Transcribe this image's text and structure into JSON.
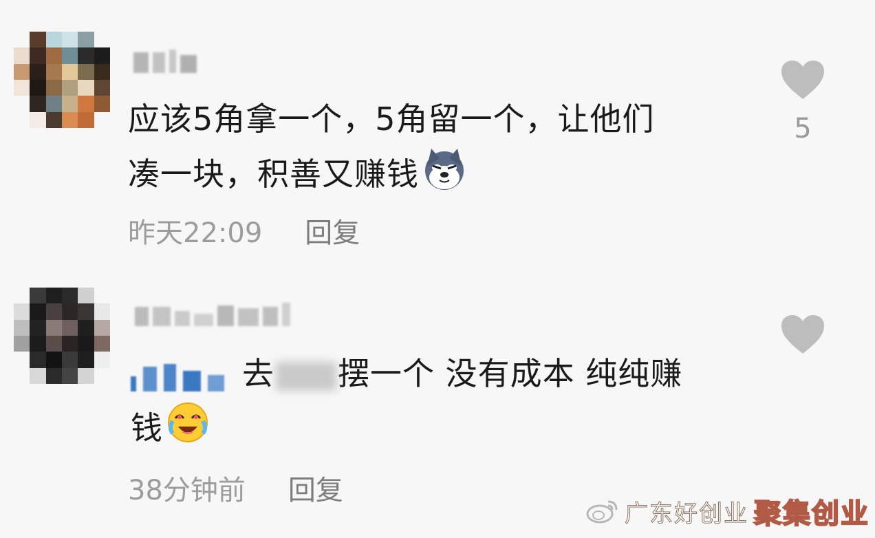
{
  "comments": [
    {
      "content_lines": [
        "应该5角拿一个，5角留一个，让他们",
        "凑一块，积善又赚钱"
      ],
      "emoji": "husky-dog-emoji",
      "time": "昨天22:09",
      "reply_label": "回复",
      "like_count": "5"
    },
    {
      "content_prefix_text": "去",
      "content_suffix_text": "摆一个 没有成本 纯纯赚",
      "content_line2": "钱",
      "emoji": "crying-laughing-emoji",
      "time": "38分钟前",
      "reply_label": "回复",
      "like_count": ""
    }
  ],
  "watermark": {
    "weibo_text": "广东好创业",
    "brand_text": "聚集创业"
  },
  "colors": {
    "background": "#f7f7f7",
    "text": "#1a1a1a",
    "meta": "#9c9c9c",
    "heart": "#bdbdbd"
  }
}
